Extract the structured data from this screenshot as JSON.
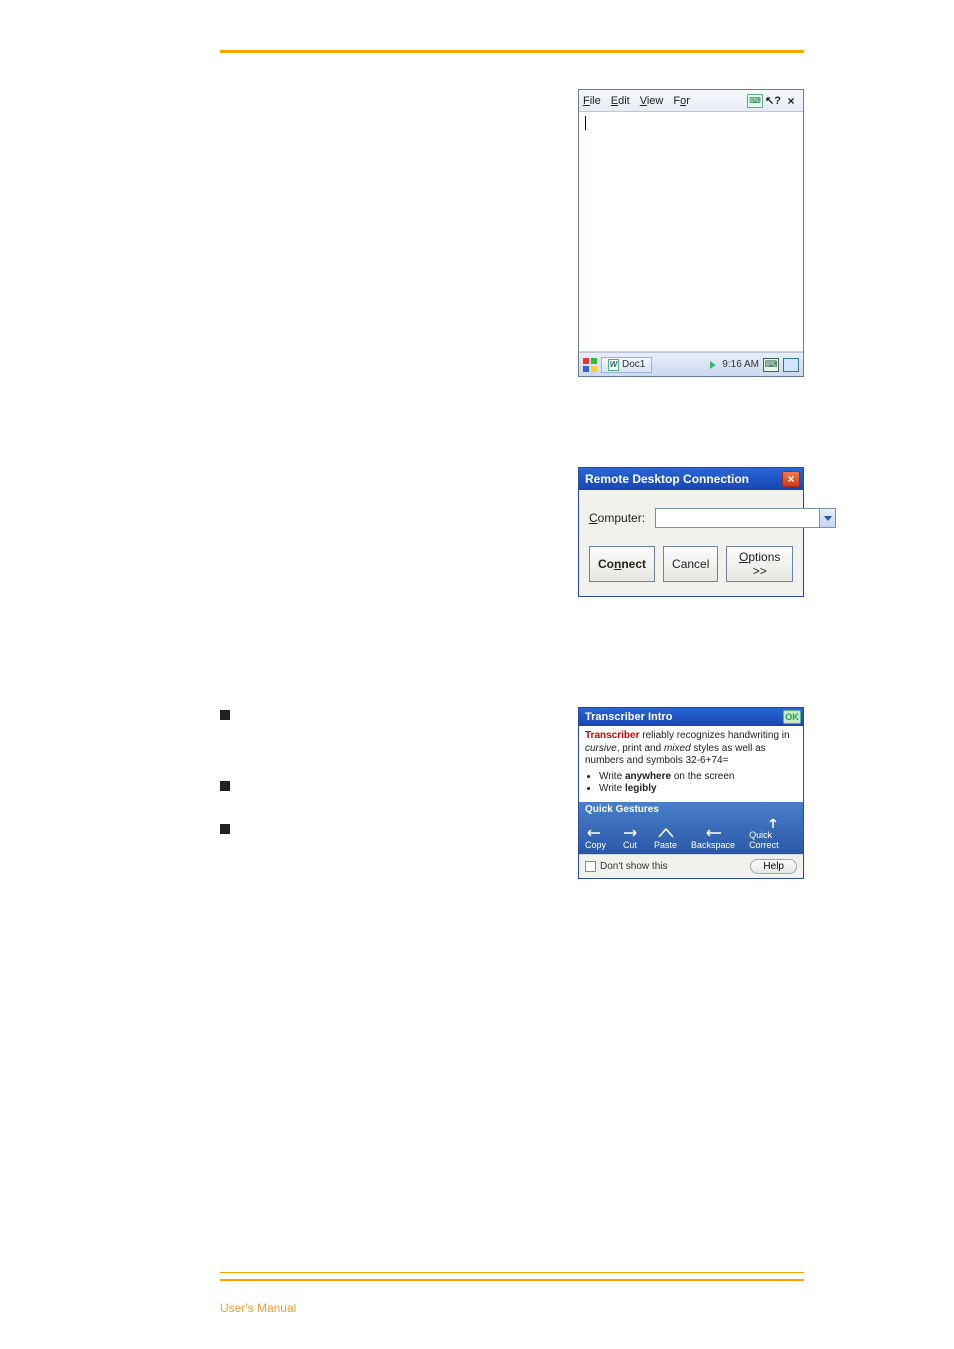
{
  "page": {
    "footer": "User's Manual"
  },
  "wordpad": {
    "menu": {
      "file": "File",
      "edit": "Edit",
      "view": "View",
      "format": "For"
    },
    "taskbar": {
      "doc_label": "Doc1",
      "time": "9:16 AM"
    }
  },
  "rdc": {
    "title": "Remote Desktop Connection",
    "computer_label": "Computer:",
    "computer_value": "",
    "connect": "Connect",
    "cancel": "Cancel",
    "options": "Options >>"
  },
  "transcriber": {
    "title": "Transcriber Intro",
    "ok": "OK",
    "line1_a": "Transcriber",
    "line1_b": " reliably recognizes handwriting in ",
    "line1_c": "cursive",
    "line1_d": ", print and ",
    "line1_e": "mixed",
    "line1_f": " styles as well as numbers and symbols 32-6+74=",
    "bullet1_a": "Write ",
    "bullet1_b": "anywhere",
    "bullet1_c": " on the screen",
    "bullet2_a": "Write ",
    "bullet2_b": "legibly",
    "gestures_title": "Quick Gestures",
    "g_copy": "Copy",
    "g_cut": "Cut",
    "g_paste": "Paste",
    "g_backspace": "Backspace",
    "g_quick": "Quick Correct",
    "dont_show": "Don't show this",
    "help": "Help"
  }
}
